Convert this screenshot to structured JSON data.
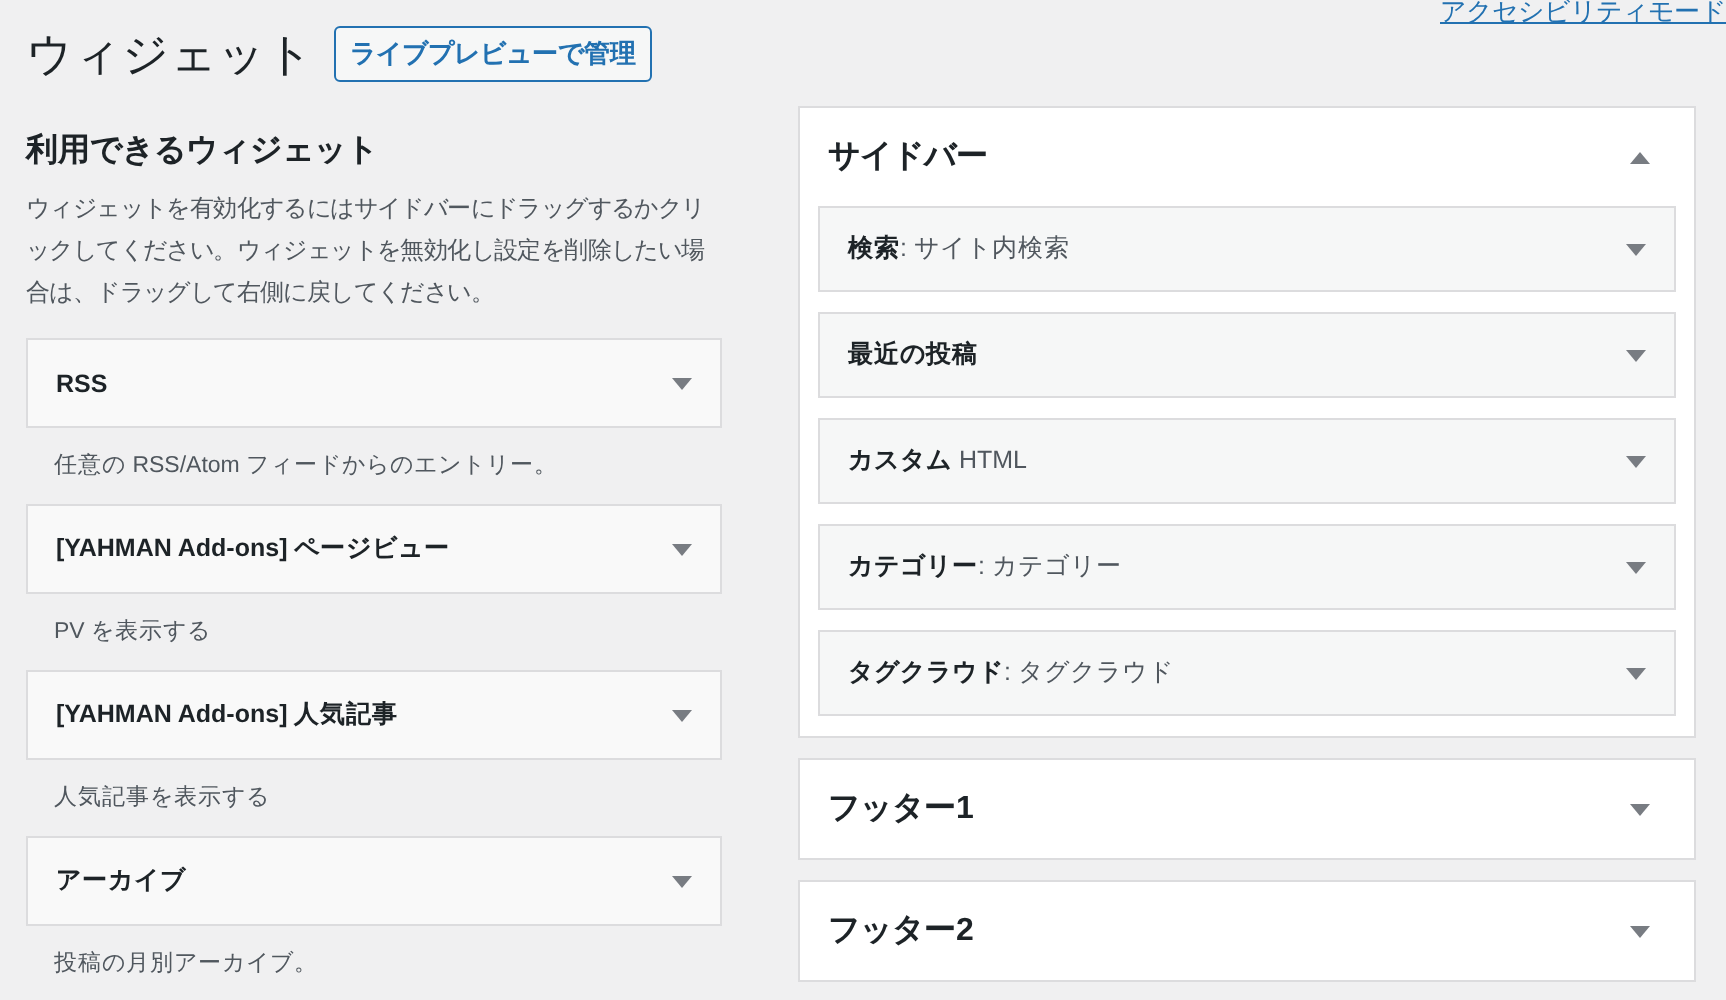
{
  "header": {
    "title": "ウィジェット",
    "manage_button": "ライブプレビューで管理",
    "accessibility_link": "アクセシビリティモード"
  },
  "available": {
    "title": "利用できるウィジェット",
    "description": "ウィジェットを有効化するにはサイドバーにドラッグするかクリックしてください。ウィジェットを無効化し設定を削除したい場合は、ドラッグして右側に戻してください。",
    "widgets": [
      {
        "title": "RSS",
        "description": "任意の RSS/Atom フィードからのエントリー。"
      },
      {
        "title": "[YAHMAN Add-ons] ページビュー",
        "description": "PV を表示する"
      },
      {
        "title": "[YAHMAN Add-ons] 人気記事",
        "description": "人気記事を表示する"
      },
      {
        "title": "アーカイブ",
        "description": "投稿の月別アーカイブ。"
      }
    ]
  },
  "areas": [
    {
      "title": "サイドバー",
      "expanded": true,
      "widgets": [
        {
          "title": "検索",
          "instance_title": ": サイト内検索"
        },
        {
          "title": "最近の投稿"
        },
        {
          "title": "カスタム",
          "instance_title": " HTML"
        },
        {
          "title": "カテゴリー",
          "instance_title": ": カテゴリー"
        },
        {
          "title": "タグクラウド",
          "instance_title": ": タグクラウド"
        }
      ]
    },
    {
      "title": "フッター1",
      "expanded": false
    },
    {
      "title": "フッター2",
      "expanded": false
    }
  ]
}
